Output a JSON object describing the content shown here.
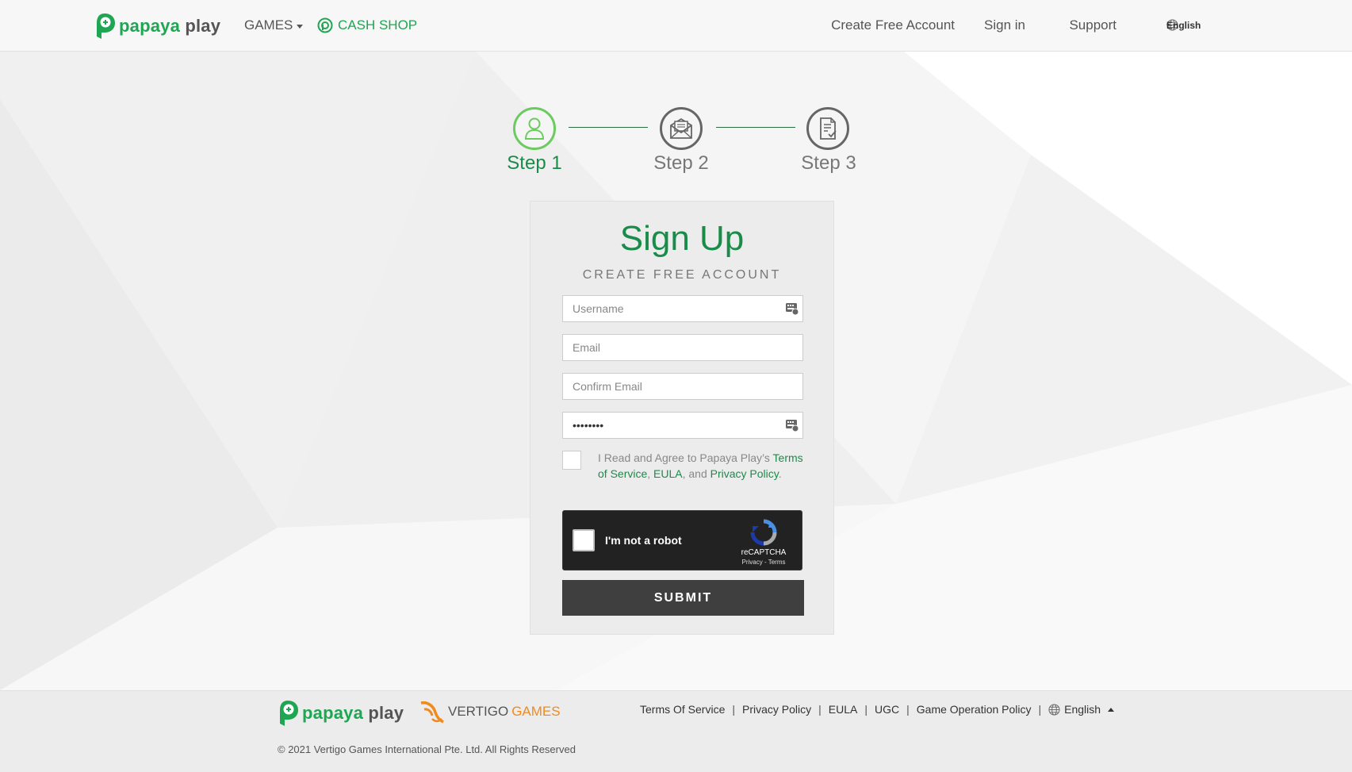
{
  "header": {
    "logo": {
      "word1": "papaya",
      "word2": "play"
    },
    "nav": {
      "games": "GAMES",
      "cash_shop": "CASH SHOP",
      "create_account": "Create Free Account",
      "sign_in": "Sign in",
      "support": "Support",
      "language": "English"
    }
  },
  "steps": [
    {
      "label": "Step 1",
      "icon": "user-icon",
      "active": true
    },
    {
      "label": "Step 2",
      "icon": "mail-icon",
      "active": false
    },
    {
      "label": "Step 3",
      "icon": "document-check-icon",
      "active": false
    }
  ],
  "form": {
    "title": "Sign Up",
    "subtitle": "CREATE FREE ACCOUNT",
    "username_placeholder": "Username",
    "email_placeholder": "Email",
    "confirm_email_placeholder": "Confirm Email",
    "password_value": "••••••••",
    "agree": {
      "prefix": "I Read and Agree to Papaya Play’s ",
      "tos": "Terms of Service",
      "comma": ", ",
      "eula": "EULA",
      "and": ", and ",
      "privacy": "Privacy Policy",
      "end": "."
    },
    "captcha": {
      "label": "I'm not a robot",
      "brand": "reCAPTCHA",
      "links": "Privacy - Terms"
    },
    "submit": "SUBMIT"
  },
  "footer": {
    "logo": {
      "word1": "papaya",
      "word2": "play"
    },
    "vertigo": {
      "word1": "VERTIGO",
      "word2": "GAMES"
    },
    "links": [
      "Terms Of Service",
      "Privacy Policy",
      "EULA",
      "UGC",
      "Game Operation Policy"
    ],
    "language": "English",
    "copyright": "© 2021 Vertigo Games International Pte. Ltd. All Rights Reserved"
  },
  "colors": {
    "brand_green": "#1ea653",
    "title_green": "#1a8c4a",
    "active_step": "#6ccb5f",
    "vertigo_orange": "#ef8a1e",
    "submit_bg": "#3f3f3f"
  }
}
